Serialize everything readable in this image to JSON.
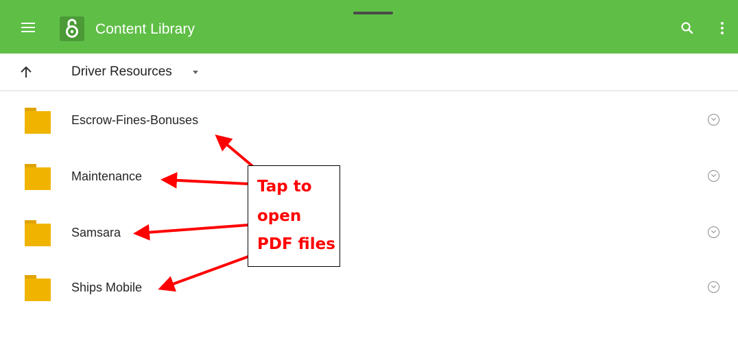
{
  "app_bar": {
    "title": "Content Library",
    "color": "#5fbe46",
    "icons": {
      "menu": "hamburger-menu-icon",
      "logo": "open-lock-logo-icon",
      "search": "search-icon",
      "more": "more-vert-icon"
    }
  },
  "path_bar": {
    "up_icon": "arrow-up-icon",
    "current_folder": "Driver Resources",
    "dropdown_icon": "caret-down-icon"
  },
  "folders": [
    {
      "name": "Escrow-Fines-Bonuses",
      "icon": "folder-icon",
      "menu_icon": "chevron-circle-down-icon"
    },
    {
      "name": "Maintenance",
      "icon": "folder-icon",
      "menu_icon": "chevron-circle-down-icon"
    },
    {
      "name": "Samsara",
      "icon": "folder-icon",
      "menu_icon": "chevron-circle-down-icon"
    },
    {
      "name": "Ships Mobile",
      "icon": "folder-icon",
      "menu_icon": "chevron-circle-down-icon"
    }
  ],
  "annotation": {
    "lines": [
      "Tap to",
      "open",
      "PDF files"
    ],
    "color": "#ff0000"
  }
}
